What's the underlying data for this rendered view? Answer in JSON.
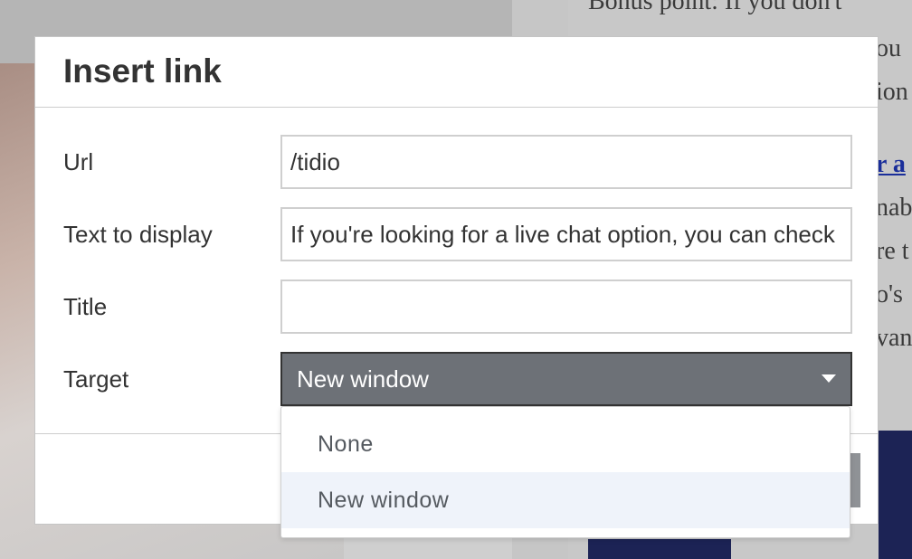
{
  "background": {
    "text_lines": [
      "Bonus point: If you don't",
      "ou",
      "ion",
      "nab",
      "re t",
      "o's",
      "van"
    ],
    "link_text": "r a"
  },
  "dialog": {
    "title": "Insert link",
    "fields": {
      "url": {
        "label": "Url",
        "value": "/tidio"
      },
      "text_to_display": {
        "label": "Text to display",
        "value": "If you're looking for a live chat option, you can check out Tidio"
      },
      "title": {
        "label": "Title",
        "value": ""
      },
      "target": {
        "label": "Target",
        "selected": "New window"
      }
    }
  },
  "dropdown": {
    "options": [
      "None",
      "New window"
    ],
    "selected_index": 1
  }
}
